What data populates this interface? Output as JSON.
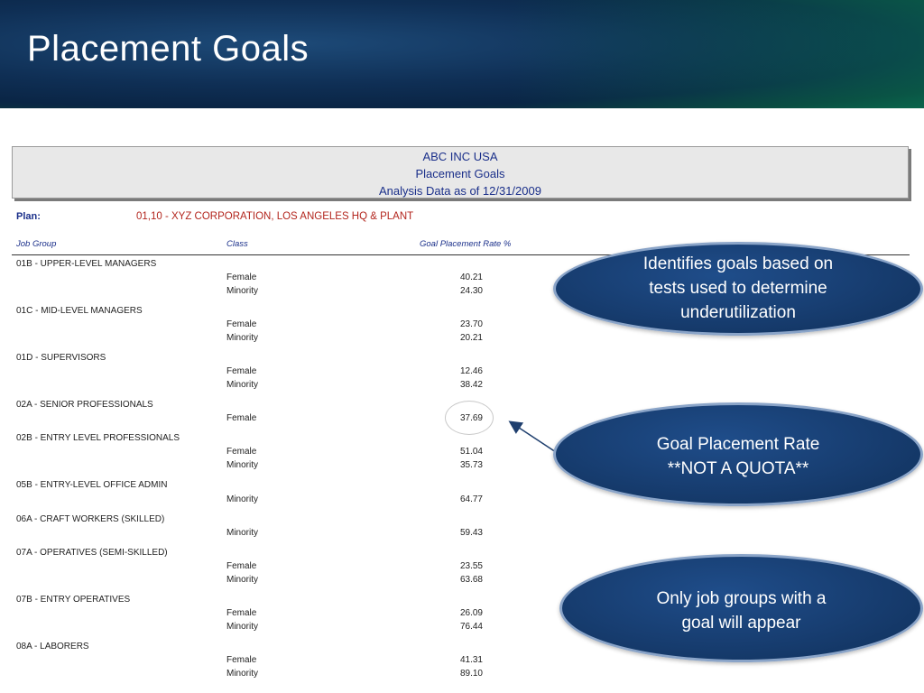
{
  "slide": {
    "title": "Placement Goals"
  },
  "report": {
    "header_lines": [
      "ABC INC USA",
      "Placement Goals",
      "Analysis Data as of 12/31/2009"
    ],
    "plan_label": "Plan:",
    "plan_value": "01,10 - XYZ CORPORATION, LOS ANGELES HQ & PLANT",
    "columns": [
      "Job Group",
      "Class",
      "Goal Placement Rate %"
    ],
    "groups": [
      {
        "name": "01B - UPPER-LEVEL MANAGERS",
        "rows": [
          {
            "class": "Female",
            "rate": "40.21"
          },
          {
            "class": "Minority",
            "rate": "24.30"
          }
        ]
      },
      {
        "name": "01C - MID-LEVEL MANAGERS",
        "rows": [
          {
            "class": "Female",
            "rate": "23.70"
          },
          {
            "class": "Minority",
            "rate": "20.21"
          }
        ]
      },
      {
        "name": "01D - SUPERVISORS",
        "rows": [
          {
            "class": "Female",
            "rate": "12.46"
          },
          {
            "class": "Minority",
            "rate": "38.42"
          }
        ]
      },
      {
        "name": "02A - SENIOR PROFESSIONALS",
        "rows": [
          {
            "class": "Female",
            "rate": "37.69"
          }
        ]
      },
      {
        "name": "02B - ENTRY LEVEL PROFESSIONALS",
        "rows": [
          {
            "class": "Female",
            "rate": "51.04"
          },
          {
            "class": "Minority",
            "rate": "35.73"
          }
        ]
      },
      {
        "name": "05B - ENTRY-LEVEL OFFICE ADMIN",
        "rows": [
          {
            "class": "Minority",
            "rate": "64.77"
          }
        ]
      },
      {
        "name": "06A - CRAFT WORKERS (SKILLED)",
        "rows": [
          {
            "class": "Minority",
            "rate": "59.43"
          }
        ]
      },
      {
        "name": "07A - OPERATIVES (SEMI-SKILLED)",
        "rows": [
          {
            "class": "Female",
            "rate": "23.55"
          },
          {
            "class": "Minority",
            "rate": "63.68"
          }
        ]
      },
      {
        "name": "07B - ENTRY OPERATIVES",
        "rows": [
          {
            "class": "Female",
            "rate": "26.09"
          },
          {
            "class": "Minority",
            "rate": "76.44"
          }
        ]
      },
      {
        "name": "08A - LABORERS",
        "rows": [
          {
            "class": "Female",
            "rate": "41.31"
          },
          {
            "class": "Minority",
            "rate": "89.10"
          }
        ]
      }
    ]
  },
  "callouts": [
    {
      "lines": [
        "Identifies goals based on",
        "tests used to determine",
        "underutilization"
      ]
    },
    {
      "lines": [
        "Goal Placement Rate",
        "**NOT A QUOTA**"
      ]
    },
    {
      "lines": [
        "Only job groups with a",
        "goal will appear"
      ]
    }
  ]
}
